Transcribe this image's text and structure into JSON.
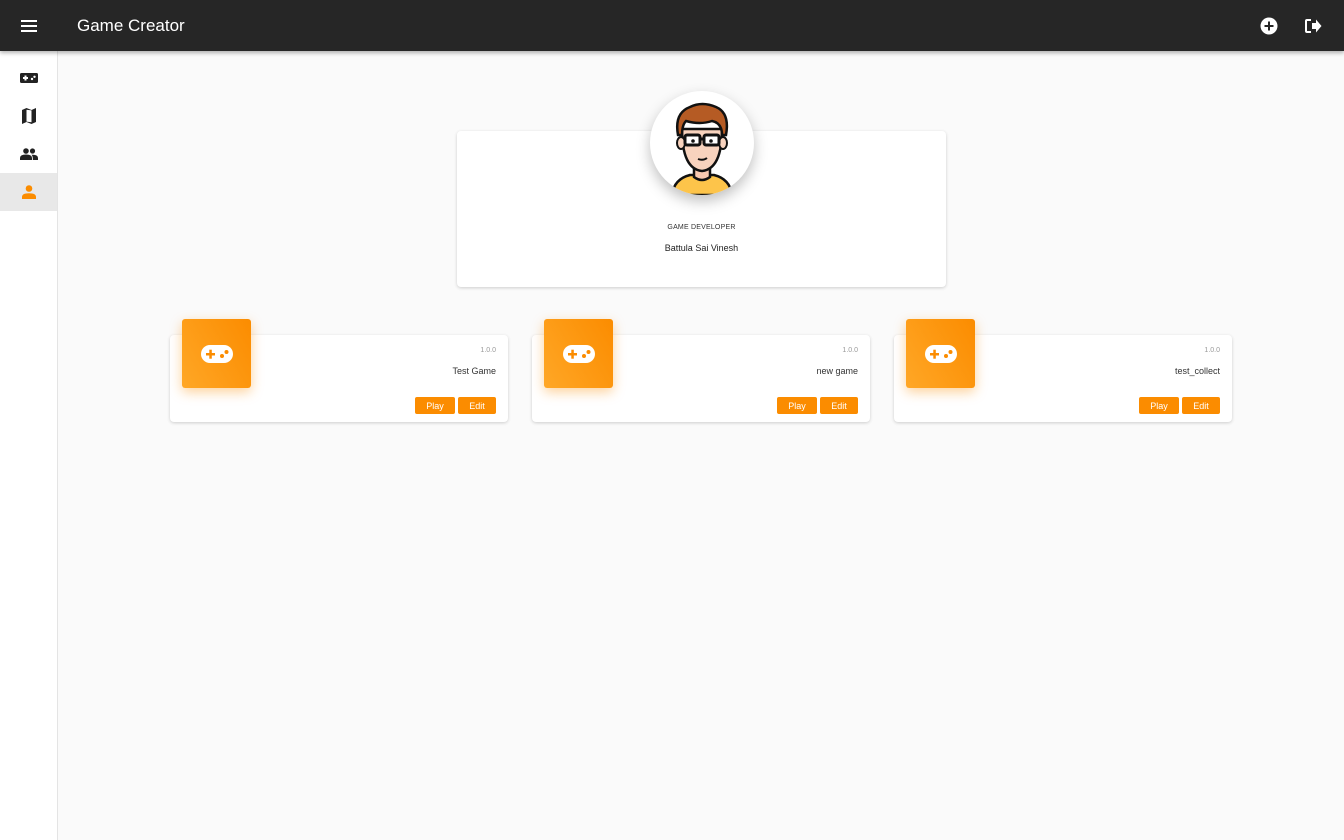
{
  "appbar": {
    "title": "Game Creator",
    "menu_icon": "hamburger-menu-icon",
    "actions": [
      {
        "name": "add-game-button",
        "icon": "plus-circle-icon"
      },
      {
        "name": "logout-button",
        "icon": "logout-icon"
      }
    ]
  },
  "sidebar": {
    "items": [
      {
        "name": "sidebar-item-games",
        "icon": "gamepad-icon",
        "active": false
      },
      {
        "name": "sidebar-item-maps",
        "icon": "map-icon",
        "active": false
      },
      {
        "name": "sidebar-item-people",
        "icon": "people-icon",
        "active": false
      },
      {
        "name": "sidebar-item-profile",
        "icon": "person-icon",
        "active": true
      }
    ]
  },
  "profile": {
    "role": "GAME DEVELOPER",
    "name": "Battula Sai Vinesh",
    "avatar_icon": "developer-avatar"
  },
  "games": [
    {
      "version": "1.0.0",
      "name": "Test Game",
      "play_label": "Play",
      "edit_label": "Edit"
    },
    {
      "version": "1.0.0",
      "name": "new game",
      "play_label": "Play",
      "edit_label": "Edit"
    },
    {
      "version": "1.0.0",
      "name": "test_collect",
      "play_label": "Play",
      "edit_label": "Edit"
    }
  ],
  "colors": {
    "appbar": "#262626",
    "accent": "#fb8c00",
    "background": "#fafafa"
  }
}
